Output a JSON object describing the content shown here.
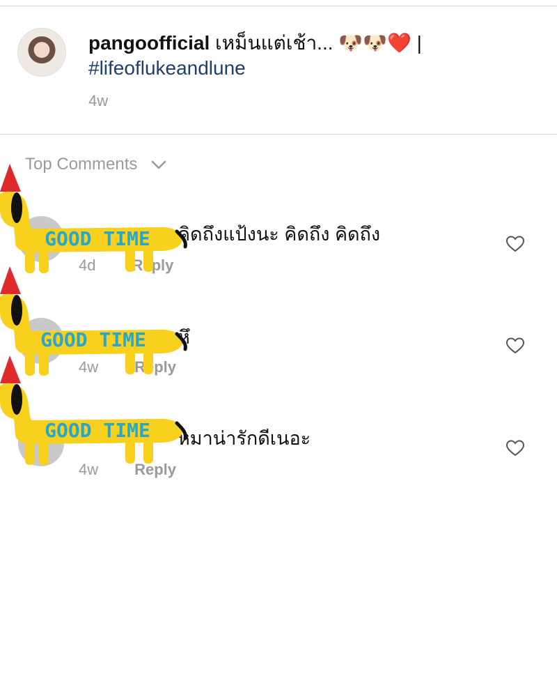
{
  "post": {
    "username": "pangoofficial",
    "caption": " เหม็นแต่เช้า... 🐶🐶❤️ |",
    "hashtag": "#lifeoflukeandlune",
    "time": "4w"
  },
  "top_comments": {
    "label": "Top Comments"
  },
  "comments": [
    {
      "text": "คิดถึงแป้งนะ คิดถึง คิดถึง",
      "time": "4d",
      "reply": "Reply"
    },
    {
      "text": "หึ",
      "time": "4w",
      "reply": "Reply"
    },
    {
      "text": "หมาน่ารักดีเนอะ",
      "time": "4w",
      "reply": "Reply"
    }
  ],
  "stickers": [
    {
      "text": "GOOD TIME"
    },
    {
      "text": "GOOD TIME"
    },
    {
      "text": "GOOD TIME"
    }
  ],
  "colors": {
    "hashtag": "#1e3f6b",
    "muted": "#9a9a9a",
    "sticker_body": "#f7d11e",
    "sticker_text": "#2aa6c9",
    "sticker_hat": "#e02a2a"
  }
}
